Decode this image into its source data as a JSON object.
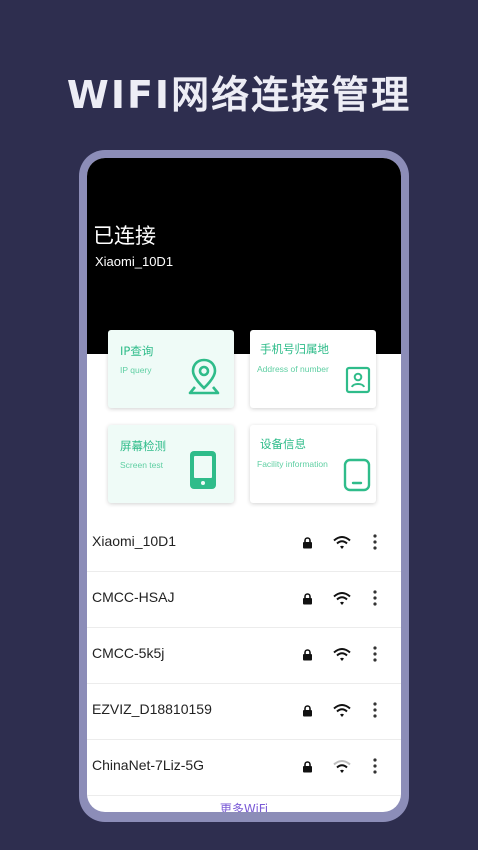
{
  "promo": {
    "title": "WIFI网络连接管理"
  },
  "hero": {
    "status": "已连接",
    "ssid": "Xiaomi_10D1"
  },
  "cards": [
    {
      "title": "IP查询",
      "subtitle": "IP query",
      "icon": "location-pin-icon"
    },
    {
      "title": "手机号归属地",
      "subtitle": "Address of number",
      "icon": "contact-card-icon"
    },
    {
      "title": "屏幕检测",
      "subtitle": "Screen test",
      "icon": "phone-icon"
    },
    {
      "title": "设备信息",
      "subtitle": "Facility information",
      "icon": "device-icon"
    }
  ],
  "networks": [
    {
      "ssid": "Xiaomi_10D1",
      "locked": true,
      "signal": "full"
    },
    {
      "ssid": "CMCC-HSAJ",
      "locked": true,
      "signal": "full"
    },
    {
      "ssid": "CMCC-5k5j",
      "locked": true,
      "signal": "full"
    },
    {
      "ssid": "EZVIZ_D18810159",
      "locked": true,
      "signal": "full"
    },
    {
      "ssid": "ChinaNet-7Liz-5G",
      "locked": true,
      "signal": "weak"
    }
  ],
  "more_link": "更多WiFi",
  "colors": {
    "accent": "#2fbc8a",
    "link": "#7a5ad6",
    "background": "#2e2e4f",
    "frame": "#8c8db8"
  }
}
